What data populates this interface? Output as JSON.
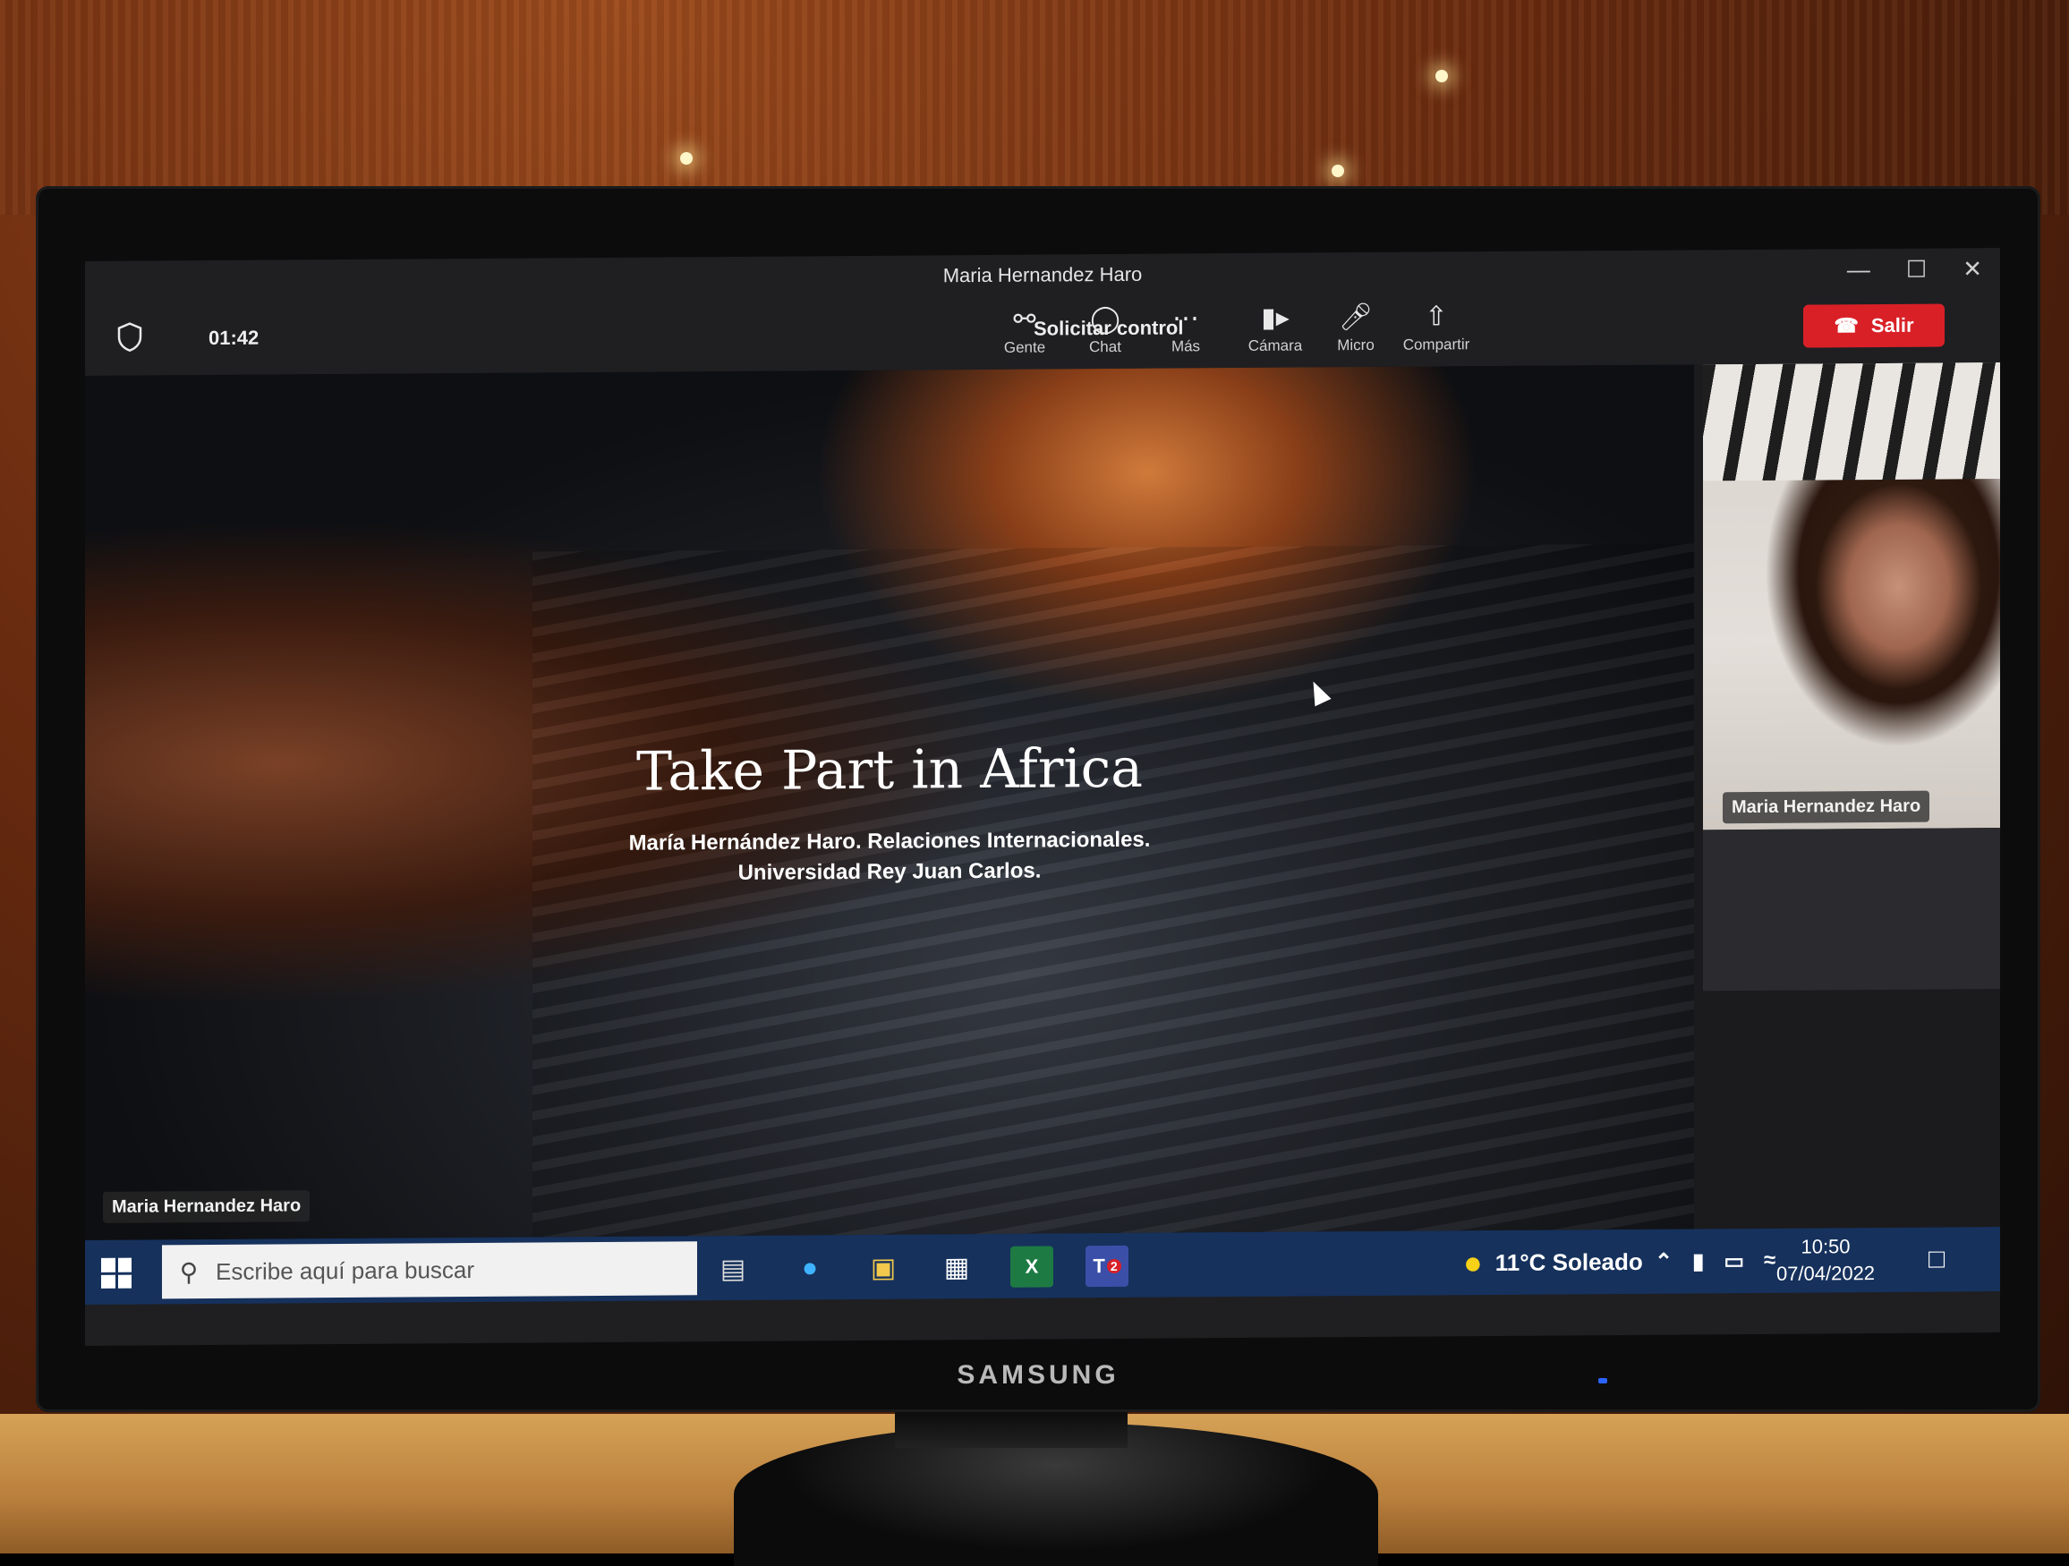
{
  "window": {
    "title": "Maria Hernandez Haro",
    "minimize_icon": "minimize-icon",
    "maximize_icon": "maximize-icon",
    "close_icon": "close-icon"
  },
  "meeting": {
    "timer": "01:42",
    "request_control": "Solicitar control",
    "buttons": [
      {
        "label": "Gente",
        "icon": "people-icon"
      },
      {
        "label": "Chat",
        "icon": "chat-icon"
      },
      {
        "label": "Más",
        "icon": "more-icon"
      },
      {
        "label": "Cámara",
        "icon": "camera-icon"
      },
      {
        "label": "Micro",
        "icon": "microphone-icon"
      },
      {
        "label": "Compartir",
        "icon": "share-icon"
      }
    ],
    "leave": "Salir",
    "leave_color": "#d92027"
  },
  "slide": {
    "title": "Take Part in Africa",
    "subtitle_line1": "María Hernández Haro. Relaciones Internacionales.",
    "subtitle_line2": "Universidad Rey Juan Carlos.",
    "presenter_tag": "Maria Hernandez Haro"
  },
  "participant": {
    "name": "Maria Hernandez Haro"
  },
  "taskbar": {
    "search_placeholder": "Escribe aquí para buscar",
    "weather": "11°C Soleado",
    "time": "10:50",
    "date": "07/04/2022",
    "teams_badge": "2",
    "color": "#16315c"
  },
  "monitor": {
    "brand": "SAMSUNG"
  }
}
